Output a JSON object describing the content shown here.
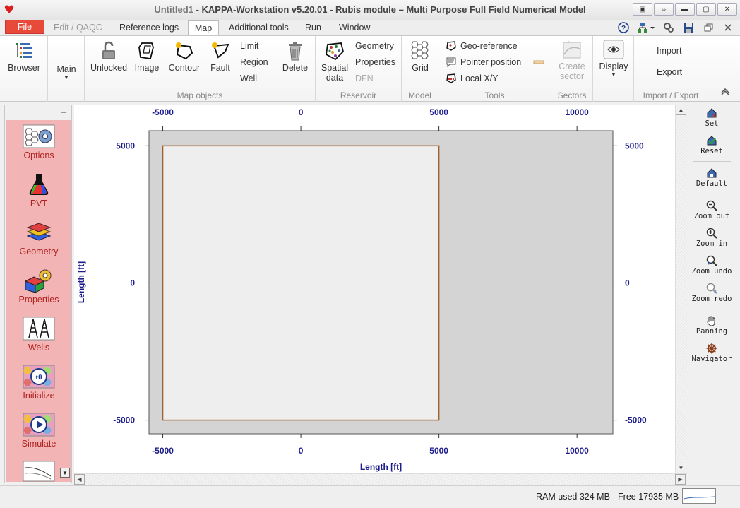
{
  "window": {
    "title_doc": "Untitled1",
    "title_rest": " - KAPPA-Workstation v5.20.01 - Rubis module – Multi Purpose Full Field Numerical Model"
  },
  "tabs": [
    "File",
    "Edit / QAQC",
    "Reference logs",
    "Map",
    "Additional tools",
    "Run",
    "Window"
  ],
  "ribbon": {
    "browser": "Browser",
    "main": "Main",
    "map_objects": {
      "label": "Map objects",
      "unlocked": "Unlocked",
      "image": "Image",
      "contour": "Contour",
      "fault": "Fault",
      "limit": "Limit",
      "region": "Region",
      "well": "Well",
      "delete": "Delete"
    },
    "reservoir": {
      "label": "Reservoir",
      "spatial_data_1": "Spatial",
      "spatial_data_2": "data",
      "geometry": "Geometry",
      "properties": "Properties",
      "dfn": "DFN"
    },
    "model": {
      "label": "Model",
      "grid": "Grid"
    },
    "tools": {
      "label": "Tools",
      "georeference": "Geo-reference",
      "pointer_position": "Pointer position",
      "local_xy": "Local X/Y"
    },
    "sectors": {
      "label": "Sectors",
      "create_1": "Create",
      "create_2": "sector"
    },
    "display": "Display",
    "import_export": {
      "label": "Import / Export",
      "import": "Import",
      "export": "Export"
    }
  },
  "left_panel": [
    "Options",
    "PVT",
    "Geometry",
    "Properties",
    "Wells",
    "Initialize",
    "Simulate"
  ],
  "right_toolbar": [
    "Set",
    "Reset",
    "Default",
    "Zoom out",
    "Zoom in",
    "Zoom undo",
    "Zoom redo",
    "Panning",
    "Navigator"
  ],
  "plot": {
    "x_ticks": [
      "-5000",
      "0",
      "5000",
      "10000"
    ],
    "y_ticks": [
      "5000",
      "0",
      "-5000"
    ],
    "xlabel": "Length [ft]",
    "ylabel": "Length [ft]",
    "x_range": [
      -5500,
      11300
    ],
    "y_range": [
      -5500,
      5550
    ],
    "reservoir_rect": {
      "x": [
        -5000,
        5000
      ],
      "y": [
        -5000,
        5000
      ]
    },
    "colors": {
      "background": "#d4d4d4",
      "reservoir_fill": "#eeeeee",
      "reservoir_border": "#a0602a",
      "axis": "#1c1c8c"
    }
  },
  "status": {
    "ram": "RAM used 324 MB - Free 17935 MB"
  }
}
